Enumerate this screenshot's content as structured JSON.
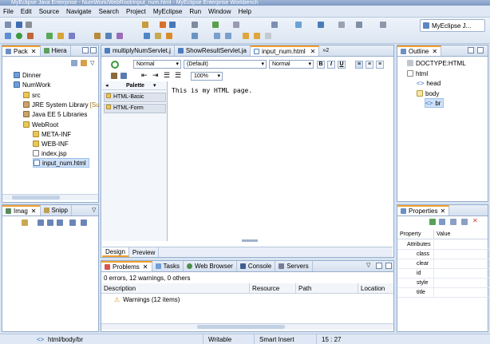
{
  "window": {
    "title": "MyEclipse Java Enterprise - NumWork/WebRoot/input_num.html - MyEclipse Enterprise Workbench"
  },
  "menu": [
    "File",
    "Edit",
    "Source",
    "Navigate",
    "Search",
    "Project",
    "MyEclipse",
    "Run",
    "Window",
    "Help"
  ],
  "perspective": {
    "label": "MyEclipse J..."
  },
  "package_view": {
    "tabs": [
      {
        "label": "Pack"
      },
      {
        "label": "Hiera"
      }
    ],
    "tree": [
      {
        "label": "Dinner",
        "icon": "project-icon"
      },
      {
        "label": "NumWork",
        "icon": "project-icon"
      },
      {
        "label": "src",
        "icon": "source-folder-icon"
      },
      {
        "label": "JRE System Library",
        "suffix": "[Su",
        "icon": "library-icon"
      },
      {
        "label": "Java EE 5 Libraries",
        "icon": "library-icon"
      },
      {
        "label": "WebRoot",
        "icon": "folder-icon"
      },
      {
        "label": "META-INF",
        "icon": "folder-icon"
      },
      {
        "label": "WEB-INF",
        "icon": "folder-icon"
      },
      {
        "label": "index.jsp",
        "icon": "jsp-file-icon"
      },
      {
        "label": "input_num.html",
        "icon": "html-file-icon"
      }
    ]
  },
  "image_view": {
    "tabs": [
      {
        "label": "Imag"
      },
      {
        "label": "Snipp"
      }
    ]
  },
  "editor": {
    "tabs": [
      {
        "label": "multiplyNumServlet.j"
      },
      {
        "label": "ShowResultServlet.ja"
      },
      {
        "label": "input_num.html"
      }
    ],
    "overflow": "»2",
    "format_select": "Normal",
    "font_select": "(Default)",
    "size_select": "Normal",
    "bold": "B",
    "italic": "I",
    "underline": "U",
    "zoom": "100%",
    "palette": {
      "title": "Palette",
      "groups": [
        "HTML-Basic",
        "HTML-Form"
      ]
    },
    "content": "This is my HTML page.",
    "bottom_tabs": [
      {
        "label": "Design"
      },
      {
        "label": "Preview"
      }
    ]
  },
  "outline": {
    "tab": "Outline",
    "tree": [
      {
        "label": "DOCTYPE:HTML"
      },
      {
        "label": "html"
      },
      {
        "label": "head"
      },
      {
        "label": "body"
      },
      {
        "label": "br"
      }
    ]
  },
  "properties": {
    "tab": "Properties",
    "headers": [
      "Property",
      "Value"
    ],
    "category": "Attributes",
    "rows": [
      "class",
      "clear",
      "id",
      "style",
      "title"
    ]
  },
  "problems": {
    "tabs": [
      {
        "label": "Problems"
      },
      {
        "label": "Tasks"
      },
      {
        "label": "Web Browser"
      },
      {
        "label": "Console"
      },
      {
        "label": "Servers"
      }
    ],
    "summary": "0 errors, 12 warnings, 0 others",
    "columns": [
      "Description",
      "Resource",
      "Path",
      "Location"
    ],
    "rows": [
      {
        "label": "Warnings (12 items)"
      }
    ]
  },
  "status": {
    "path": "html/body/br",
    "mode": "Writable",
    "insert": "Smart Insert",
    "position": "15 : 27"
  }
}
